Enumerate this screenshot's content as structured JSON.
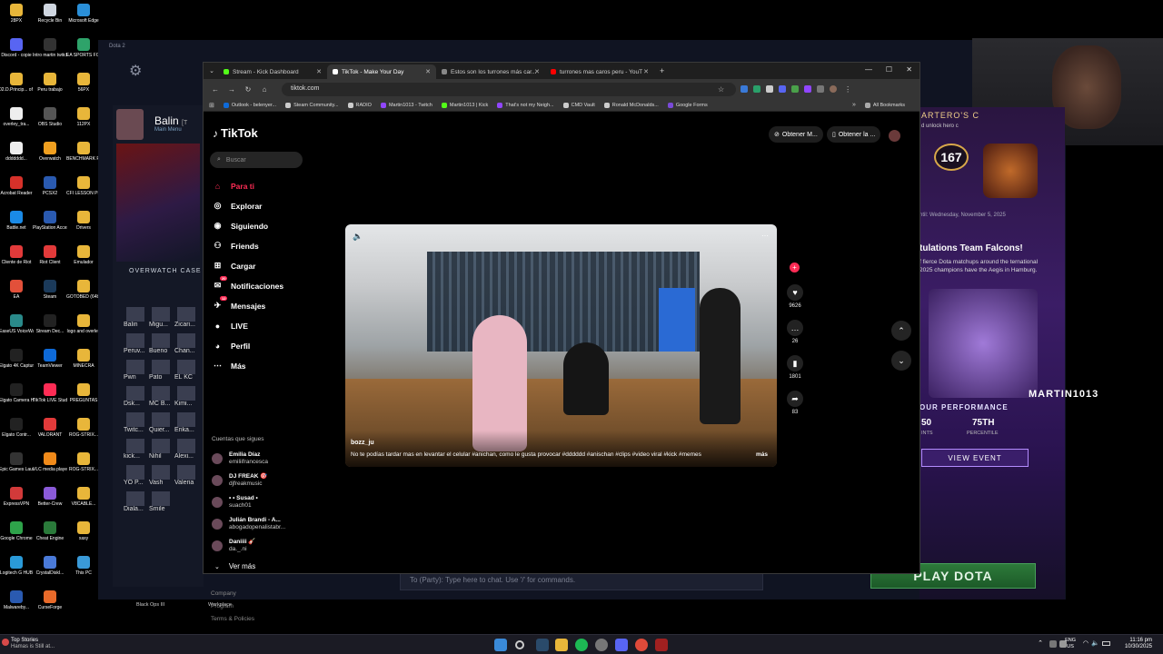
{
  "desktop": {
    "icons": [
      {
        "label": "28PX",
        "color": "#e8b63a"
      },
      {
        "label": "Recycle Bin",
        "color": "#cfd6e0"
      },
      {
        "label": "Microsoft Edge",
        "color": "#2a8fd8"
      },
      {
        "label": "Discord - copie",
        "color": "#5865f2"
      },
      {
        "label": "Intro martin twitch",
        "color": "#333333"
      },
      {
        "label": "EA SPORTS FC™ 25",
        "color": "#2ea36a"
      },
      {
        "label": "02.D.Princip... of Flight C...",
        "color": "#e8b63a"
      },
      {
        "label": "Peru trabajo",
        "color": "#e8b63a"
      },
      {
        "label": "56PX",
        "color": "#e8b63a"
      },
      {
        "label": "overley_tra...",
        "color": "#eeeeee"
      },
      {
        "label": "OBS Studio",
        "color": "#555555"
      },
      {
        "label": "112PX",
        "color": "#e8b63a"
      },
      {
        "label": "ddddddd...",
        "color": "#eeeeee"
      },
      {
        "label": "Overwatch",
        "color": "#f0a020"
      },
      {
        "label": "BENCHMARK RESULTS",
        "color": "#e8b63a"
      },
      {
        "label": "Acrobat Reader",
        "color": "#d6312a"
      },
      {
        "label": "PCSX2",
        "color": "#2a5ab0"
      },
      {
        "label": "CFI LESSON PLANS",
        "color": "#e8b63a"
      },
      {
        "label": "Battle.net",
        "color": "#1a8ae6"
      },
      {
        "label": "PlayStation Accessories",
        "color": "#2a5ab0"
      },
      {
        "label": "Drivers",
        "color": "#e8b63a"
      },
      {
        "label": "Cliente de Riot",
        "color": "#e23a3a"
      },
      {
        "label": "Riot Client",
        "color": "#e23a3a"
      },
      {
        "label": "Emulador",
        "color": "#e8b63a"
      },
      {
        "label": "EA",
        "color": "#e2503a"
      },
      {
        "label": "Steam",
        "color": "#1b3a5a"
      },
      {
        "label": "GOTOBED (64bit)",
        "color": "#e8b63a"
      },
      {
        "label": "EaseUS VoiceWave",
        "color": "#2a8a8a"
      },
      {
        "label": "Stream Dec...",
        "color": "#222222"
      },
      {
        "label": "logo and overley",
        "color": "#e8b63a"
      },
      {
        "label": "Elgato 4K Capture...",
        "color": "#222222"
      },
      {
        "label": "TeamViewer",
        "color": "#0e6ad8"
      },
      {
        "label": "MINECRA",
        "color": "#e8b63a"
      },
      {
        "label": "Elgato Camera Hub",
        "color": "#222222"
      },
      {
        "label": "TikTok LIVE Studio",
        "color": "#fe2c55"
      },
      {
        "label": "PREGUNTAS",
        "color": "#e8b63a"
      },
      {
        "label": "Elgato Contr...",
        "color": "#222222"
      },
      {
        "label": "VALORANT",
        "color": "#e23a3a"
      },
      {
        "label": "ROG-STRIX...",
        "color": "#e8b63a"
      },
      {
        "label": "Epic Games Launcher",
        "color": "#333333"
      },
      {
        "label": "VLC media player",
        "color": "#f08a1a"
      },
      {
        "label": "ROG-STRIX...",
        "color": "#e8b63a"
      },
      {
        "label": "ExpressVPN",
        "color": "#d23a3a"
      },
      {
        "label": "Better-Crew",
        "color": "#8a5ad8"
      },
      {
        "label": "V8CABLE...",
        "color": "#e8b63a"
      },
      {
        "label": "Google Chrome",
        "color": "#2ea34a"
      },
      {
        "label": "Cheat Engine",
        "color": "#2a7a3a"
      },
      {
        "label": "xaxy",
        "color": "#e8b63a"
      },
      {
        "label": "Logitech G HUB",
        "color": "#2a9ad8"
      },
      {
        "label": "CrystalDiskI...",
        "color": "#4a7ad8"
      },
      {
        "label": "This PC",
        "color": "#3a9ad8"
      },
      {
        "label": "Malwareby...",
        "color": "#2a5ab0"
      },
      {
        "label": "CurseForge",
        "color": "#e86a2a"
      }
    ]
  },
  "dota": {
    "window_title": "Dota 2",
    "player_name": "Balin",
    "player_tag": "[T",
    "player_sub": "Main Menu",
    "case_label": "OVERWATCH CASE",
    "friends": [
      "Balin",
      "Migu...",
      "Zicari...",
      "Peruv...",
      "Bueno",
      "Chan...",
      "Pwn",
      "Pato",
      "EL KC",
      "Dsk...",
      "MC B...",
      "Kimi...",
      "Twitc...",
      "Quier...",
      "Erika...",
      "kick...",
      "Nihil",
      "Alexi...",
      "YO P...",
      "Vash",
      "Valeria",
      "Diala...",
      "Smile"
    ],
    "promo_counter": "167",
    "promo_header": "ARTERO'S C",
    "promo_sub": "d unlock hero c",
    "promo_date": "ntil: Wednesday, November 5, 2025",
    "news_title": "tulations Team Falcons!",
    "news_body": "f fierce Dota matchups around the ternational 2025 champions have the Aegis in Hamburg.",
    "perf_title": "OUR PERFORMANCE",
    "perf_left": "50",
    "perf_left_label": "INTS",
    "perf_value": "75TH",
    "perf_label": "PERCENTILE",
    "view_event": "VIEW EVENT",
    "overlay_name": "MARTIN1013",
    "chat_placeholder": "To (Party): Type here to chat. Use '/' for commands.",
    "play_button": "PLAY DOTA",
    "bottom_game": "Black Ops III",
    "bottom_label": "Workplace"
  },
  "browser": {
    "tabs": [
      {
        "title": "Stream - Kick Dashboard",
        "color": "#53fc18",
        "active": false
      },
      {
        "title": "TikTok - Make Your Day",
        "color": "#ffffff",
        "active": true
      },
      {
        "title": "Estos son los turrones más car...",
        "color": "#888888",
        "active": false
      },
      {
        "title": "turrones mas caros peru - YouT",
        "color": "#ff0000",
        "active": false
      }
    ],
    "new_tab": "+",
    "url": "tiktok.com",
    "bookmarks": [
      {
        "label": "Outlook - belenyer...",
        "color": "#0e6ad8"
      },
      {
        "label": "Steam Community...",
        "color": "#cccccc"
      },
      {
        "label": "RADIO",
        "color": "#cccccc"
      },
      {
        "label": "Martin1013 - Twitch",
        "color": "#9146ff"
      },
      {
        "label": "Martin1013 | Kick",
        "color": "#53fc18"
      },
      {
        "label": "That's not my Neigh...",
        "color": "#9146ff"
      },
      {
        "label": "CMD Vault",
        "color": "#cccccc"
      },
      {
        "label": "Ronald McDonalds...",
        "color": "#cccccc"
      },
      {
        "label": "Google Forms",
        "color": "#7a4ad8"
      }
    ],
    "all_bookmarks": "All Bookmarks"
  },
  "tiktok": {
    "logo": "TikTok",
    "search_placeholder": "Buscar",
    "nav": [
      {
        "label": "Para ti",
        "icon": "home-icon",
        "active": true
      },
      {
        "label": "Explorar",
        "icon": "compass-icon",
        "active": false
      },
      {
        "label": "Siguiendo",
        "icon": "following-icon",
        "active": false
      },
      {
        "label": "Friends",
        "icon": "friends-icon",
        "active": false
      },
      {
        "label": "Cargar",
        "icon": "upload-icon",
        "active": false
      },
      {
        "label": "Notificaciones",
        "icon": "bell-icon",
        "active": false,
        "badge": "20"
      },
      {
        "label": "Mensajes",
        "icon": "messages-icon",
        "active": false,
        "badge": "12"
      },
      {
        "label": "LIVE",
        "icon": "live-icon",
        "active": false
      },
      {
        "label": "Perfil",
        "icon": "profile-icon",
        "active": false
      },
      {
        "label": "Más",
        "icon": "more-icon",
        "active": false
      }
    ],
    "following_title": "Cuentas que sigues",
    "accounts": [
      {
        "name": "Emilia Díaz",
        "handle": "emiliifrancesca"
      },
      {
        "name": "DJ FREAK 🎯",
        "handle": "djfreakmusic"
      },
      {
        "name": "• • Susad •",
        "handle": "suach01"
      },
      {
        "name": "Julián Brandi - A...",
        "handle": "abogadopenalistabr..."
      },
      {
        "name": "Daniiii 🎸",
        "handle": "da._.ni"
      }
    ],
    "see_more": "Ver más",
    "footer": [
      "Company",
      "Program",
      "Terms & Policies"
    ],
    "top_buttons": [
      "Obtener M...",
      "Obtener la ..."
    ],
    "video": {
      "username": "bozz_ju",
      "caption": "No te podías tardar mas en levantar el celular #anichan, como le gusta provocar #dddddd #anischan #clips #video viral #kick #memes",
      "more": "más"
    },
    "actions": [
      {
        "icon": "heart-icon",
        "count": "9626"
      },
      {
        "icon": "comment-icon",
        "count": "26"
      },
      {
        "icon": "bookmark-icon",
        "count": "1801"
      },
      {
        "icon": "share-icon",
        "count": "83"
      }
    ]
  },
  "taskbar": {
    "news_title": "Top Stories",
    "news_sub": "Hamas is Still at...",
    "lang_top": "ENG",
    "lang_bottom": "US",
    "time": "11:16 pm",
    "date": "10/30/2025"
  }
}
